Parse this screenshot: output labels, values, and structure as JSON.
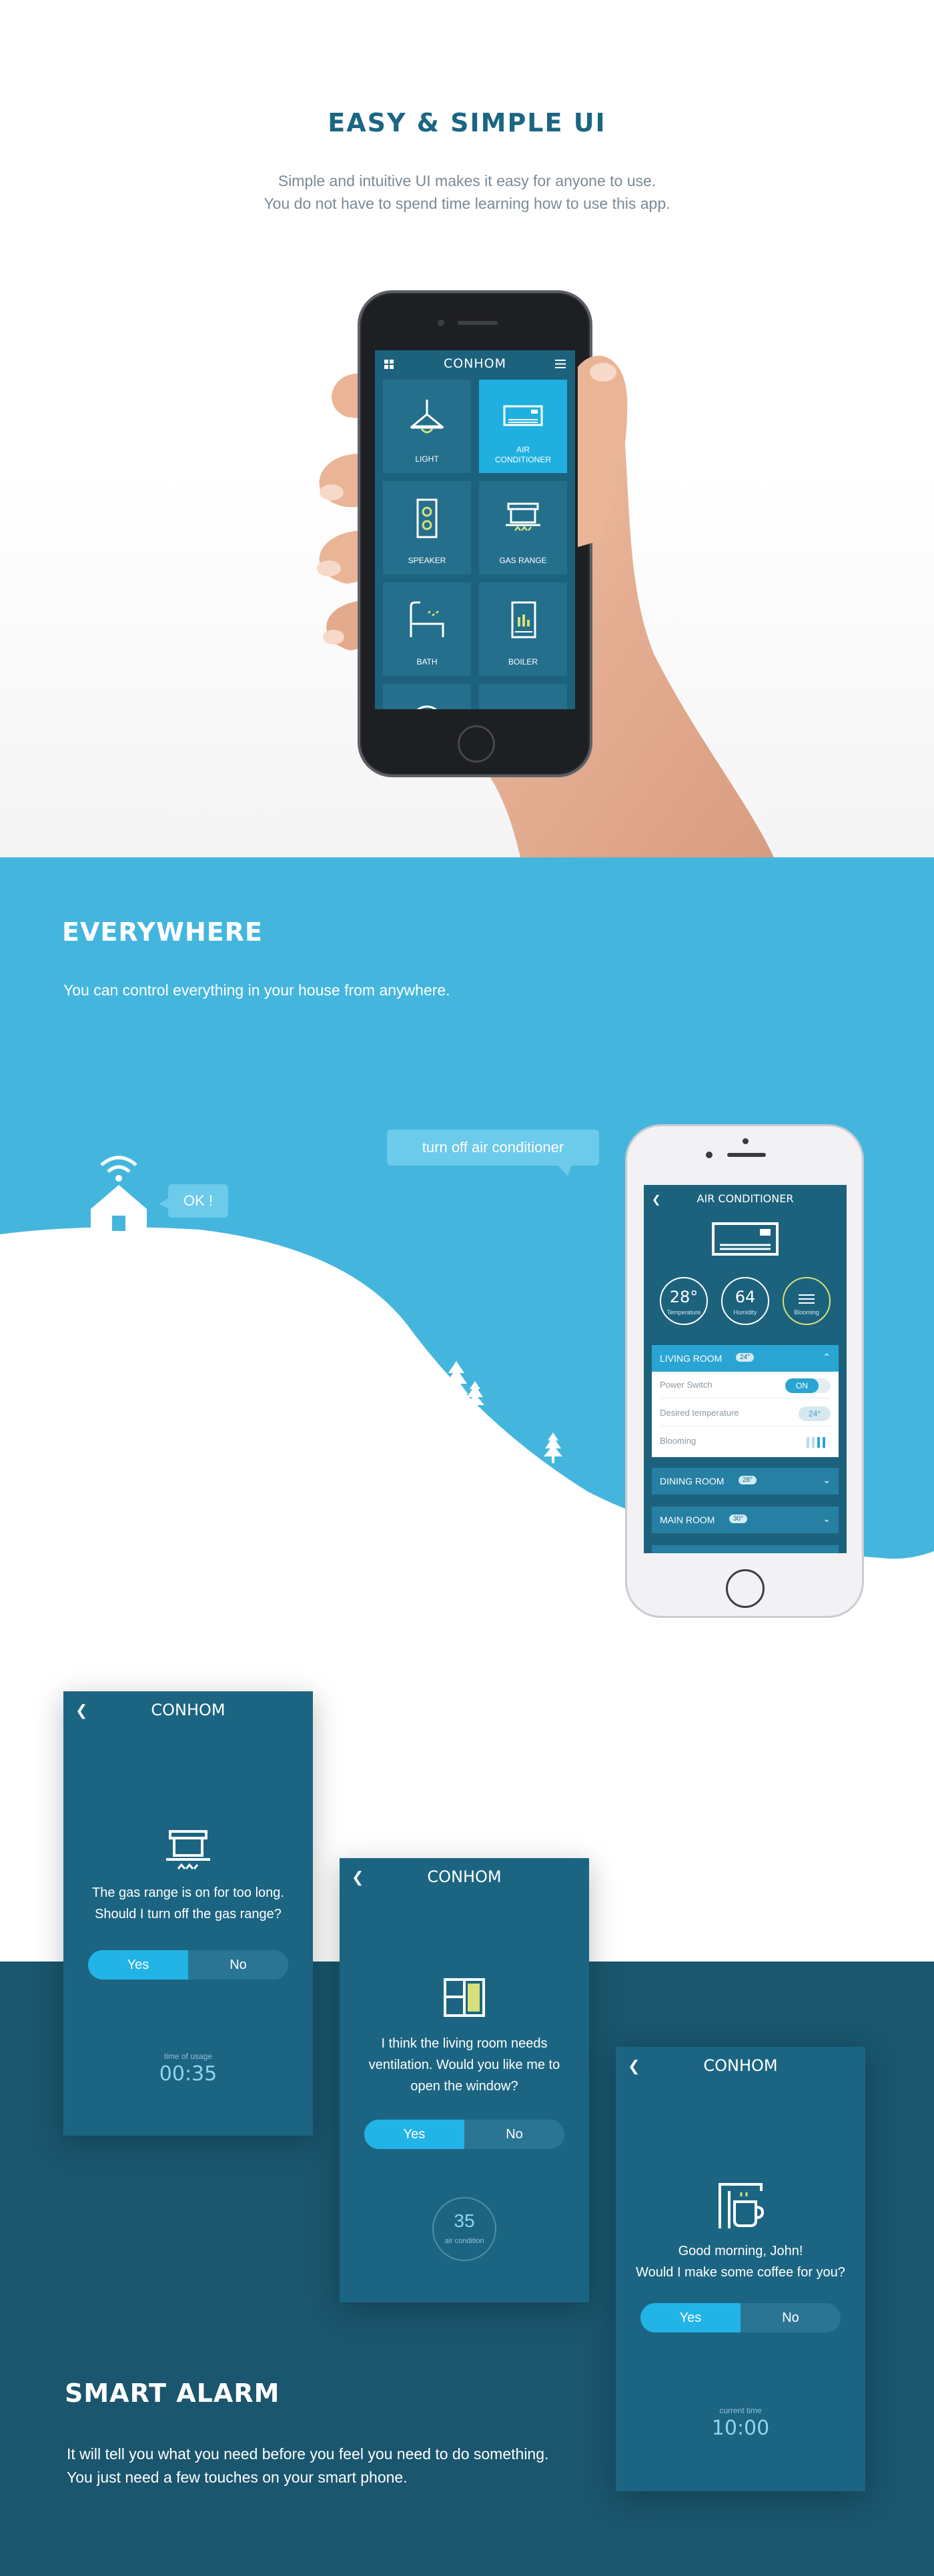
{
  "section1": {
    "title": "EASY & SIMPLE UI",
    "desc_line1": "Simple and intuitive UI makes it easy for anyone to use.",
    "desc_line2": "You do not have to spend time learning how to use this app.",
    "app": {
      "brand": "CONHOM",
      "tiles": [
        {
          "label": "LIGHT",
          "icon": "lamp-icon"
        },
        {
          "label_line1": "AIR",
          "label_line2": "CONDITIONER",
          "icon": "air-conditioner-icon",
          "active": true
        },
        {
          "label": "SPEAKER",
          "icon": "speaker-icon"
        },
        {
          "label": "GAS RANGE",
          "icon": "gas-range-icon"
        },
        {
          "label": "BATH",
          "icon": "bathtub-icon"
        },
        {
          "label": "BOILER",
          "icon": "boiler-icon"
        }
      ]
    }
  },
  "section2": {
    "title": "EVERYWHERE",
    "desc": "You can control everything in your house from anywhere.",
    "bubble_phone": "turn off air conditioner",
    "bubble_house": "OK !",
    "app": {
      "title": "AIR CONDITIONER",
      "gauges": [
        {
          "value": "28°",
          "label": "Temperature"
        },
        {
          "value": "64",
          "label": "Humidity"
        },
        {
          "value": "",
          "label": "Blooming"
        }
      ],
      "rooms": [
        {
          "name": "LIVING ROOM",
          "temp": "24°",
          "expanded": true
        },
        {
          "name": "DINING ROOM",
          "temp": "28°"
        },
        {
          "name": "MAIN ROOM",
          "temp": "30°"
        }
      ],
      "rows": {
        "power_label": "Power Switch",
        "power_value": "ON",
        "temp_label": "Desired temperature",
        "temp_value": "24°",
        "bloom_label": "Blooming"
      }
    }
  },
  "section3": {
    "title": "SMART ALARM",
    "desc_line1": "It will tell you what you need before you feel you need to do something.",
    "desc_line2": "You just need a few touches on your smart phone.",
    "cards": [
      {
        "brand": "CONHOM",
        "msg_line1": "The gas range is on for too long.",
        "msg_line2": "Should I turn off the gas range?",
        "yes": "Yes",
        "no": "No",
        "info_label": "time of usage",
        "info_value": "00:35"
      },
      {
        "brand": "CONHOM",
        "msg_line1": "I think the living room needs",
        "msg_line2": "ventilation. Would you like me to",
        "msg_line3": "open the window?",
        "yes": "Yes",
        "no": "No",
        "ring_value": "35",
        "ring_label": "air condition"
      },
      {
        "brand": "CONHOM",
        "msg_line1": "Good morning, John!",
        "msg_line2": "Would I make some coffee for you?",
        "yes": "Yes",
        "no": "No",
        "info_label": "current time",
        "info_value": "10:00"
      }
    ]
  },
  "colors": {
    "title_blue": "#1b6683",
    "sky_blue": "#44b6de",
    "app_bg": "#1c627d",
    "accent": "#22b4e6",
    "dark_band": "#1a566e"
  }
}
